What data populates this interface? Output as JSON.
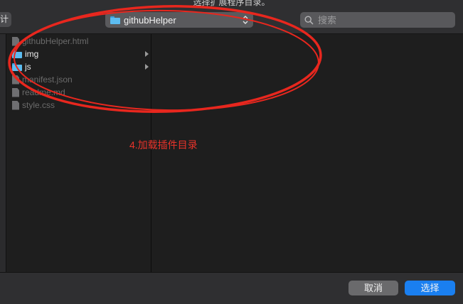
{
  "dialog": {
    "title": "选择扩展程序目录。"
  },
  "toolbar": {
    "back_label": "计",
    "path_popup": {
      "label": "githubHelper",
      "icon": "folder-icon"
    },
    "search": {
      "placeholder": "搜索",
      "value": "",
      "icon": "search-icon"
    }
  },
  "files": [
    {
      "name": "githubHelper.html",
      "type": "file",
      "enabled": false,
      "icon": "document-icon"
    },
    {
      "name": "img",
      "type": "folder",
      "enabled": true,
      "icon": "folder-icon"
    },
    {
      "name": "js",
      "type": "folder",
      "enabled": true,
      "icon": "folder-icon"
    },
    {
      "name": "manifest.json",
      "type": "file",
      "enabled": false,
      "icon": "document-icon"
    },
    {
      "name": "readme.md",
      "type": "file",
      "enabled": false,
      "icon": "document-icon"
    },
    {
      "name": "style.css",
      "type": "file",
      "enabled": false,
      "icon": "document-icon"
    }
  ],
  "annotation": {
    "text": "4.加载插件目录",
    "color": "#e8332a"
  },
  "buttons": {
    "cancel": "取消",
    "choose": "选择"
  },
  "colors": {
    "accent": "#1a7ff0",
    "folder": "#5cbcf0"
  }
}
